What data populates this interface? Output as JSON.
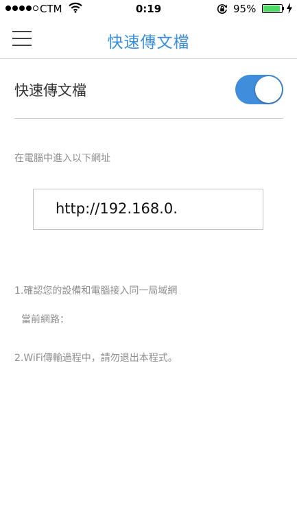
{
  "status_bar": {
    "carrier": "CTM",
    "time": "0:19",
    "battery_percent": "95%",
    "battery_level": 0.95,
    "signal_bars_filled": 4,
    "signal_bars_total": 5
  },
  "header": {
    "title": "快速傳文檔",
    "menu_icon": "hamburger-menu-icon"
  },
  "settings": {
    "toggle_label": "快速傳文檔",
    "toggle_on": true,
    "accent_color": "#3f8ddb"
  },
  "instructions": {
    "hint": "在電腦中進入以下網址",
    "url": "http://192.168.0.",
    "note1": "1.確認您的設備和電腦接入同一局域網",
    "current_network_label": "當前網路：",
    "note2": "2.WiFi傳輸過程中，請勿退出本程式。"
  }
}
